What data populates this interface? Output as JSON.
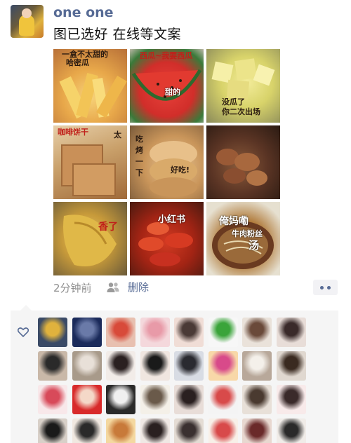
{
  "post": {
    "username": "one one",
    "caption": "图已选好 在线等文案",
    "time": "2分钟前",
    "delete_label": "删除"
  },
  "images": [
    {
      "name": "image-fries",
      "texts": [
        "一盒不太甜的",
        "哈密瓜"
      ]
    },
    {
      "name": "image-watermelon",
      "texts": [
        "西瓜~我要西瓜",
        "甜的"
      ]
    },
    {
      "name": "image-melon",
      "texts": [
        "没瓜了",
        "你二次出场"
      ]
    },
    {
      "name": "image-crackers",
      "texts": [
        "咖啡饼干",
        "太"
      ]
    },
    {
      "name": "image-bread",
      "texts": [
        "吃",
        "烤",
        "一",
        "下",
        "好吃!"
      ]
    },
    {
      "name": "image-meat",
      "texts": []
    },
    {
      "name": "image-chicken",
      "texts": [
        "香了"
      ]
    },
    {
      "name": "image-crayfish",
      "texts": [
        "小红书"
      ]
    },
    {
      "name": "image-noodles",
      "texts": [
        "俺妈嘞",
        "牛肉粉丝",
        "汤"
      ]
    }
  ],
  "colors": {
    "link": "#576b95",
    "meta": "#8f8f8f",
    "panel": "#f5f5f5"
  },
  "likers": [
    {
      "name": "liker-avatar-1",
      "c1": "#3a4a66",
      "c2": "#e0b23d"
    },
    {
      "name": "liker-avatar-2",
      "c1": "#1a2a5a",
      "c2": "#6a7aa8"
    },
    {
      "name": "liker-avatar-3",
      "c1": "#e8c0b0",
      "c2": "#d84a3a"
    },
    {
      "name": "liker-avatar-4",
      "c1": "#f4d8dc",
      "c2": "#e89aa8"
    },
    {
      "name": "liker-avatar-5",
      "c1": "#f0ddd6",
      "c2": "#4a3a36"
    },
    {
      "name": "liker-avatar-6",
      "c1": "#f7f7f7",
      "c2": "#3aa43a"
    },
    {
      "name": "liker-avatar-7",
      "c1": "#eae2da",
      "c2": "#6a4a3a"
    },
    {
      "name": "liker-avatar-8",
      "c1": "#e8ddd8",
      "c2": "#3a2a2a"
    },
    {
      "name": "liker-avatar-9",
      "c1": "#c9b8a8",
      "c2": "#2a2a2a"
    },
    {
      "name": "liker-avatar-10",
      "c1": "#a89a8a",
      "c2": "#e8e0d8"
    },
    {
      "name": "liker-avatar-11",
      "c1": "#f2ece8",
      "c2": "#2a2020"
    },
    {
      "name": "liker-avatar-12",
      "c1": "#f0e6e0",
      "c2": "#1a1a1a"
    },
    {
      "name": "liker-avatar-13",
      "c1": "#d8dce4",
      "c2": "#2a2a30"
    },
    {
      "name": "liker-avatar-14",
      "c1": "#f8d8a8",
      "c2": "#d84a8a"
    },
    {
      "name": "liker-avatar-15",
      "c1": "#b8a89a",
      "c2": "#f4f0ea"
    },
    {
      "name": "liker-avatar-16",
      "c1": "#e0d8d0",
      "c2": "#3a2a20"
    },
    {
      "name": "liker-avatar-17",
      "c1": "#f8e8ea",
      "c2": "#d84a5a"
    },
    {
      "name": "liker-avatar-18",
      "c1": "#d82a2a",
      "c2": "#f4d8c8"
    },
    {
      "name": "liker-avatar-19",
      "c1": "#2a2a2a",
      "c2": "#f0f0f0"
    },
    {
      "name": "liker-avatar-20",
      "c1": "#f4f0e8",
      "c2": "#6a5a4a"
    },
    {
      "name": "liker-avatar-21",
      "c1": "#e8ddd8",
      "c2": "#2a2020"
    },
    {
      "name": "liker-avatar-22",
      "c1": "#f4f4f4",
      "c2": "#d84a4a"
    },
    {
      "name": "liker-avatar-23",
      "c1": "#e8e0d8",
      "c2": "#4a3a30"
    },
    {
      "name": "liker-avatar-24",
      "c1": "#f8eaea",
      "c2": "#3a2a2a"
    },
    {
      "name": "liker-avatar-25",
      "c1": "#d8d0c8",
      "c2": "#1a1a1a"
    },
    {
      "name": "liker-avatar-26",
      "c1": "#f0e8e0",
      "c2": "#2a2a2a"
    },
    {
      "name": "liker-avatar-27",
      "c1": "#f4d8a0",
      "c2": "#c87a3a"
    },
    {
      "name": "liker-avatar-28",
      "c1": "#f0e8e4",
      "c2": "#2a2020"
    },
    {
      "name": "liker-avatar-29",
      "c1": "#e4dcd4",
      "c2": "#3a3030"
    },
    {
      "name": "liker-avatar-30",
      "c1": "#f8f0e8",
      "c2": "#d84a4a"
    },
    {
      "name": "liker-avatar-31",
      "c1": "#e8d8d0",
      "c2": "#6a2a2a"
    },
    {
      "name": "liker-avatar-32",
      "c1": "#f0ece8",
      "c2": "#2a2a2a"
    }
  ]
}
